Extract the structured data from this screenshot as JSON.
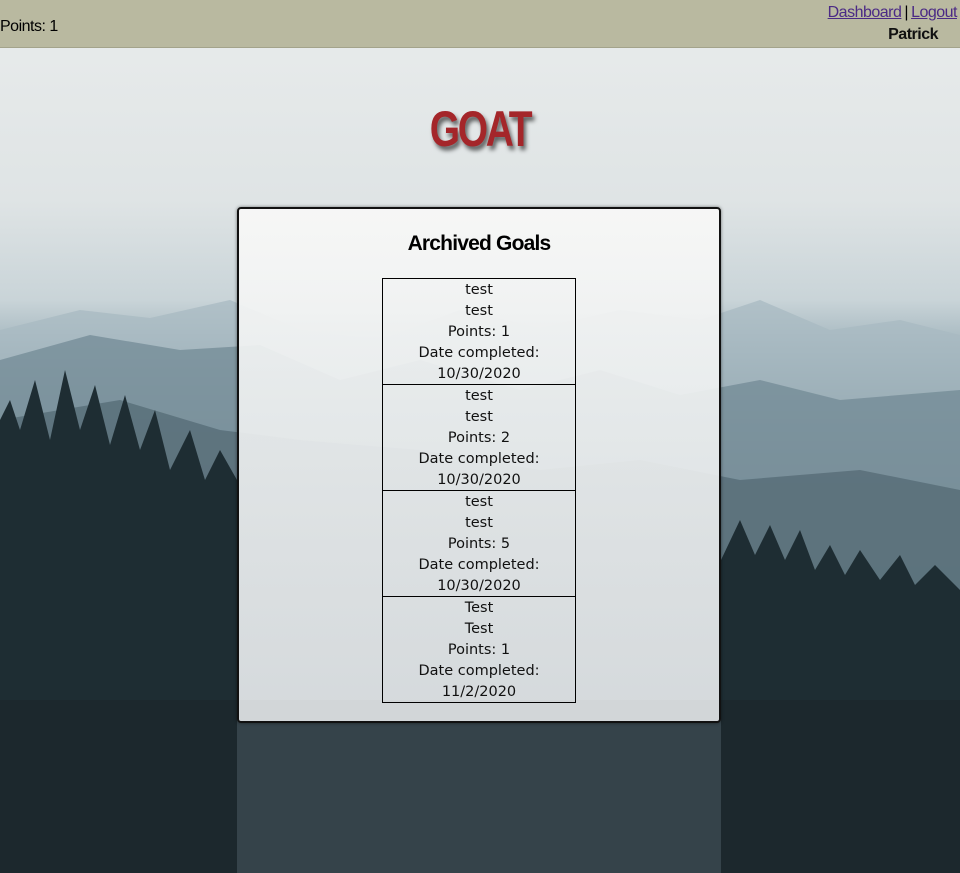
{
  "header": {
    "points_text": "Points: 1",
    "nav": {
      "dashboard_label": "Dashboard",
      "separator": "|",
      "logout_label": "Logout"
    },
    "username": "Patrick"
  },
  "logo_text": "GOAT",
  "archived": {
    "title": "Archived Goals",
    "goals": [
      {
        "title": "test",
        "description": "test",
        "points": "Points: 1",
        "date_label": "Date completed:",
        "date": "10/30/2020"
      },
      {
        "title": "test",
        "description": "test",
        "points": "Points: 2",
        "date_label": "Date completed:",
        "date": "10/30/2020"
      },
      {
        "title": "test",
        "description": "test",
        "points": "Points: 5",
        "date_label": "Date completed:",
        "date": "10/30/2020"
      },
      {
        "title": "Test",
        "description": "Test",
        "points": "Points: 1",
        "date_label": "Date completed:",
        "date": "11/2/2020"
      }
    ]
  },
  "colors": {
    "topbar": "#b9b9a0",
    "link": "#4b2a85",
    "logo": "#a4262a"
  }
}
